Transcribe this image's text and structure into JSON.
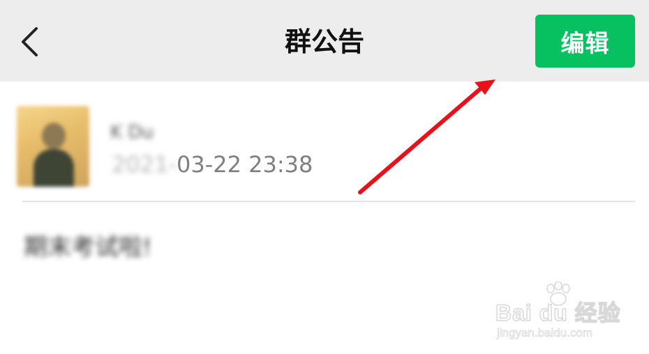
{
  "header": {
    "title": "群公告",
    "back_icon": "chevron-left-icon",
    "edit_label": "编辑"
  },
  "post": {
    "author_name": "K Du",
    "time_year": "2021-",
    "time_rest": "03-22 23:38",
    "announcement_text": "期末考试啦!"
  },
  "watermark": {
    "brand": "Bai du 经验",
    "url": "jingyan.baidu.com"
  },
  "colors": {
    "header_bg": "#ededed",
    "edit_button": "#07c160",
    "arrow": "#e8111a",
    "divider": "#e4e4e4"
  }
}
